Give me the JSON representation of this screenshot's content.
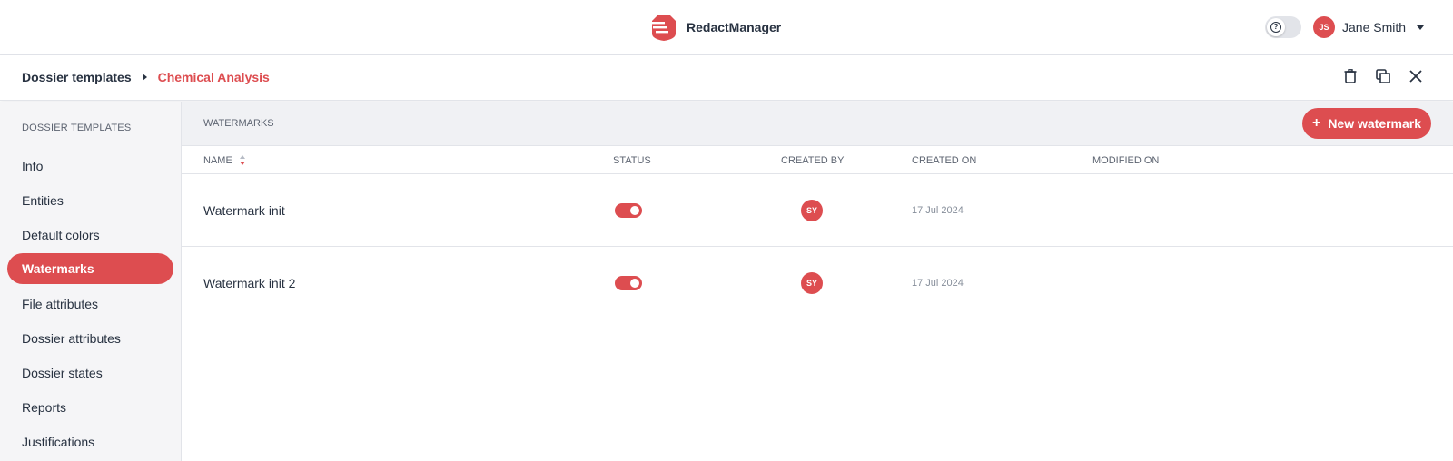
{
  "app": {
    "name": "RedactManager"
  },
  "user": {
    "initials": "JS",
    "name": "Jane Smith"
  },
  "breadcrumb": {
    "root": "Dossier templates",
    "current": "Chemical Analysis"
  },
  "sidebar": {
    "title": "DOSSIER TEMPLATES",
    "items": [
      {
        "label": "Info"
      },
      {
        "label": "Entities"
      },
      {
        "label": "Default colors"
      },
      {
        "label": "Watermarks",
        "active": true
      },
      {
        "label": "File attributes"
      },
      {
        "label": "Dossier attributes"
      },
      {
        "label": "Dossier states"
      },
      {
        "label": "Reports"
      },
      {
        "label": "Justifications"
      }
    ]
  },
  "content": {
    "title": "WATERMARKS",
    "new_button_label": "New watermark",
    "columns": [
      "NAME",
      "STATUS",
      "CREATED BY",
      "CREATED ON",
      "MODIFIED ON"
    ],
    "rows": [
      {
        "name": "Watermark init",
        "status_on": true,
        "created_by": "SY",
        "created_on": "17 Jul 2024",
        "modified_on": ""
      },
      {
        "name": "Watermark init 2",
        "status_on": true,
        "created_by": "SY",
        "created_on": "17 Jul 2024",
        "modified_on": ""
      }
    ]
  },
  "icons": {
    "logo": "redactmanager-logo-icon",
    "help": "help-icon",
    "caret": "chevron-down-icon",
    "actions": [
      "delete-icon",
      "copy-icon",
      "close-icon"
    ],
    "sort": "sort-icon"
  },
  "colors": {
    "accent": "#dd4d50",
    "text": "#283241",
    "muted": "#5c6370",
    "sidebar_bg": "#f5f5f7"
  }
}
